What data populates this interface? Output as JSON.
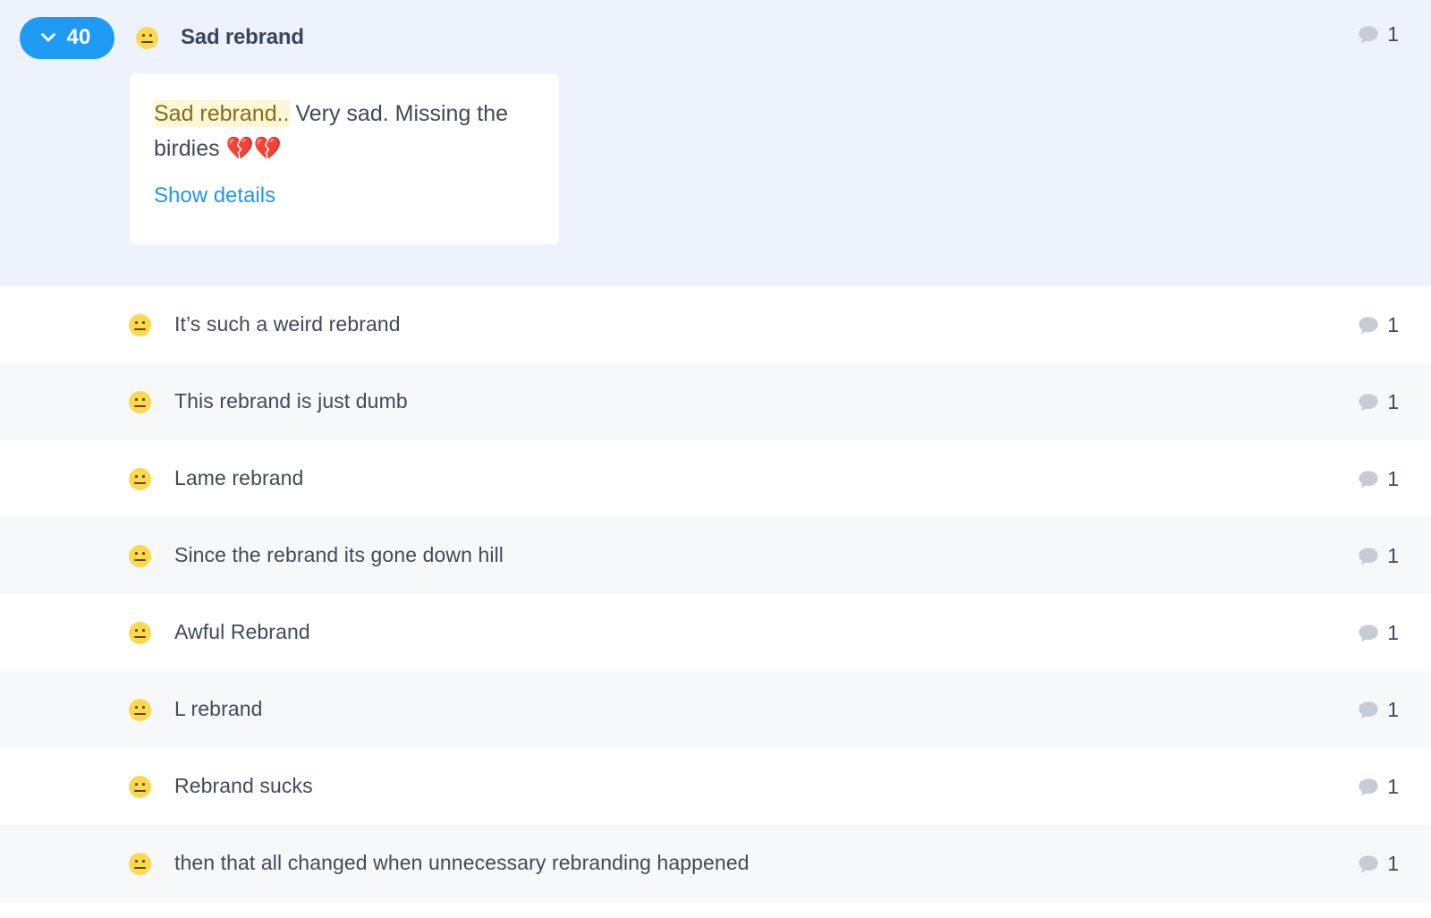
{
  "header": {
    "count_badge": {
      "value": "40",
      "icon": "chevron-down-icon",
      "color": "#1f9bf5"
    },
    "sentiment_icon": "neutral-face-emoji",
    "title": "Sad rebrand",
    "comment_icon": "comment-bubble-icon",
    "comment_count": "1",
    "background_color": "#eef2fd"
  },
  "quote_card": {
    "highlight_text": "Sad rebrand..",
    "body_text": " Very sad. Missing the birdies 💔💔",
    "highlight_bg": "#fcf8d7",
    "highlight_color": "#8a6c18",
    "link_label": "Show details",
    "link_color": "#2196f3"
  },
  "mentions": [
    {
      "sentiment_icon": "neutral-face-emoji",
      "text": "It’s such a weird rebrand",
      "comment_icon": "comment-bubble-icon",
      "comment_count": "1"
    },
    {
      "sentiment_icon": "neutral-face-emoji",
      "text": "This rebrand is just dumb",
      "comment_icon": "comment-bubble-icon",
      "comment_count": "1"
    },
    {
      "sentiment_icon": "neutral-face-emoji",
      "text": "Lame rebrand",
      "comment_icon": "comment-bubble-icon",
      "comment_count": "1"
    },
    {
      "sentiment_icon": "neutral-face-emoji",
      "text": "Since the rebrand its gone down hill",
      "comment_icon": "comment-bubble-icon",
      "comment_count": "1"
    },
    {
      "sentiment_icon": "neutral-face-emoji",
      "text": "Awful Rebrand",
      "comment_icon": "comment-bubble-icon",
      "comment_count": "1"
    },
    {
      "sentiment_icon": "neutral-face-emoji",
      "text": "L rebrand",
      "comment_icon": "comment-bubble-icon",
      "comment_count": "1"
    },
    {
      "sentiment_icon": "neutral-face-emoji",
      "text": "Rebrand sucks",
      "comment_icon": "comment-bubble-icon",
      "comment_count": "1"
    },
    {
      "sentiment_icon": "neutral-face-emoji",
      "text": "then that all changed when unnecessary rebranding happened",
      "comment_icon": "comment-bubble-icon",
      "comment_count": "1"
    }
  ],
  "row_colors": {
    "odd": "#ffffff",
    "even": "#f7f8fa"
  }
}
